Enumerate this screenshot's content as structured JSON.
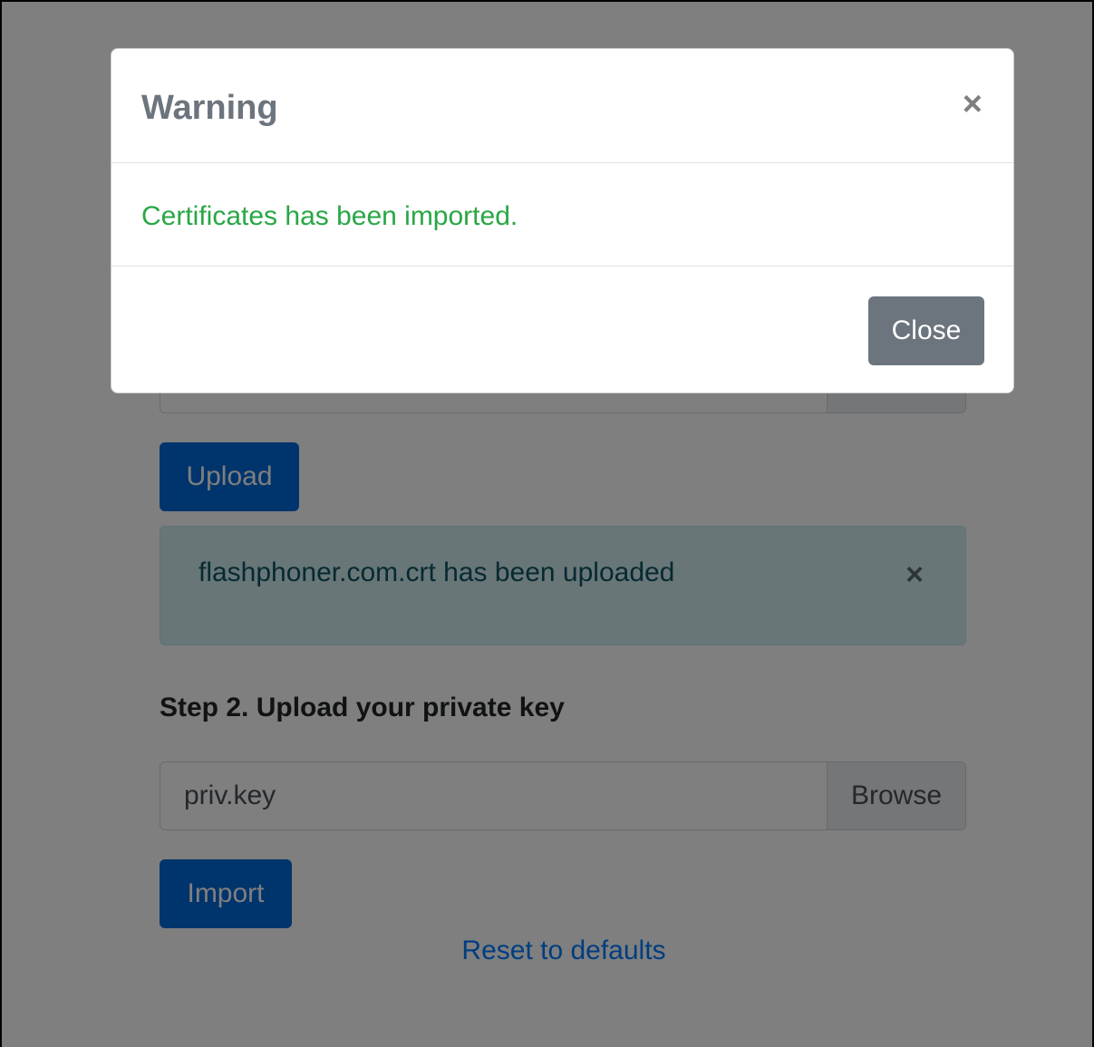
{
  "page": {
    "step1": {
      "file_name": "",
      "browse_label": "",
      "upload_label": "Upload",
      "alert_text": "flashphoner.com.crt has been uploaded",
      "alert_close_glyph": "×"
    },
    "step2": {
      "heading": "Step 2. Upload your private key",
      "file_name": "priv.key",
      "browse_label": "Browse",
      "import_label": "Import"
    },
    "reset_link": "Reset to defaults"
  },
  "modal": {
    "title": "Warning",
    "close_glyph": "×",
    "message": "Certificates has been imported.",
    "close_button_label": "Close"
  },
  "colors": {
    "primary": "#0069d9",
    "secondary": "#6c757d",
    "success_text": "#28a745",
    "link": "#007bff",
    "alert_bg": "#d1ecf1"
  }
}
